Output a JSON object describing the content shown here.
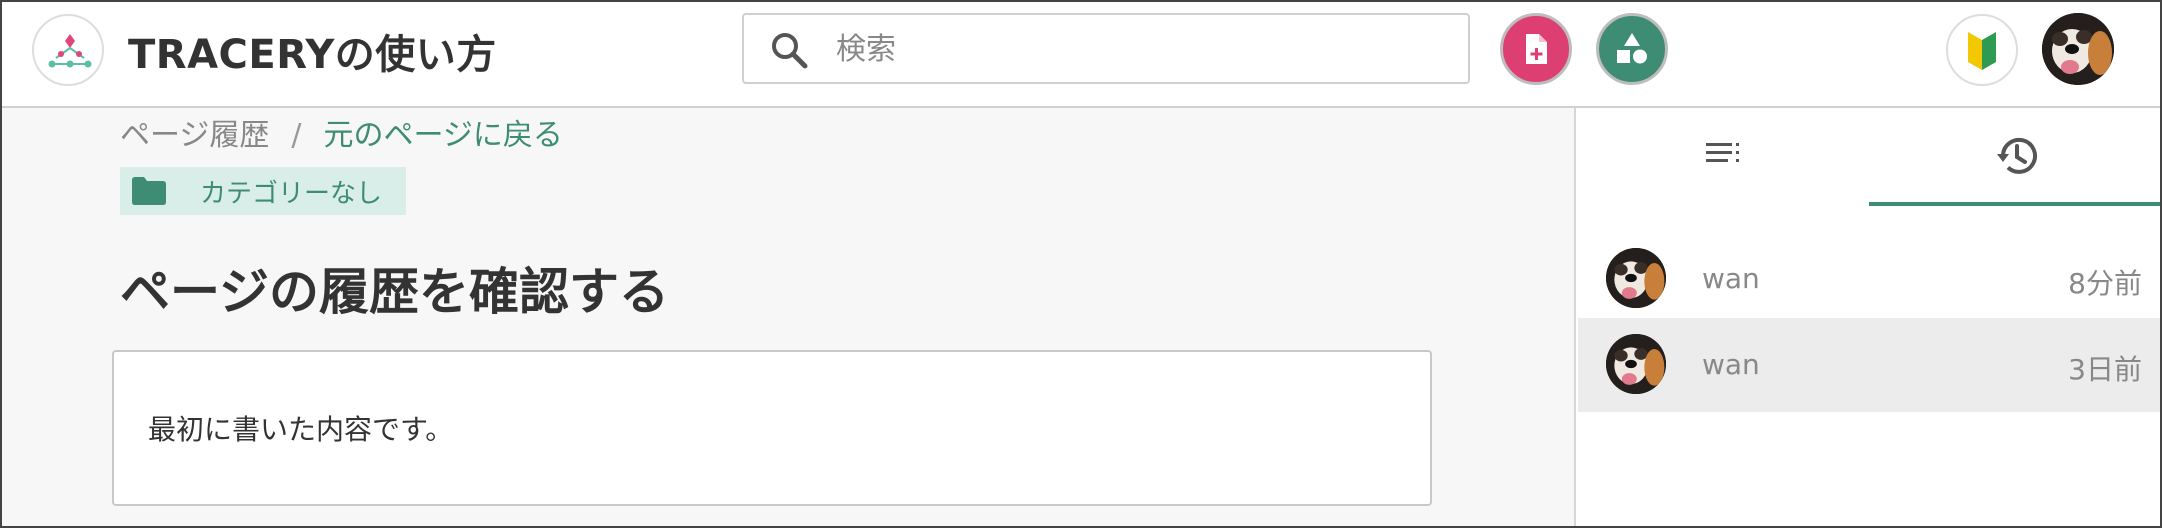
{
  "header": {
    "title": "TRACERYの使い方",
    "search_placeholder": "検索"
  },
  "breadcrumb": {
    "current": "ページ履歴",
    "separator": "/",
    "back_link": "元のページに戻る"
  },
  "category": {
    "label": "カテゴリーなし"
  },
  "page": {
    "title": "ページの履歴を確認する",
    "content": "最初に書いた内容です。"
  },
  "sidebar": {
    "tabs": [
      {
        "icon": "toc-list-icon",
        "selected": false
      },
      {
        "icon": "history-icon",
        "selected": true
      }
    ],
    "history": [
      {
        "user": "wan",
        "time": "8分前",
        "selected": false
      },
      {
        "user": "wan",
        "time": "3日前",
        "selected": true
      }
    ]
  },
  "colors": {
    "accent_green": "#3e8c74",
    "new_page_pink": "#dd3f72",
    "category_bg": "#d9eee9"
  }
}
